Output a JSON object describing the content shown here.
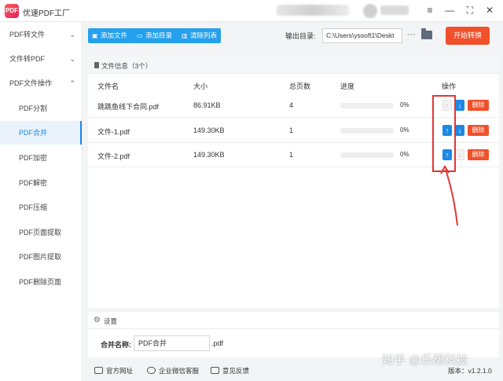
{
  "app": {
    "logo_text": "PDF",
    "title": "优速PDF工厂"
  },
  "window_controls": {
    "menu": "≡",
    "minimize": "—",
    "maximize": "⛶",
    "close": "✕"
  },
  "sidebar": {
    "items": [
      {
        "label": "PDF转文件",
        "chevron": "⌄"
      },
      {
        "label": "文件转PDF",
        "chevron": "⌄"
      },
      {
        "label": "PDF文件操作",
        "chevron": "⌃"
      },
      {
        "label": "PDF分割"
      },
      {
        "label": "PDF合并"
      },
      {
        "label": "PDF加密"
      },
      {
        "label": "PDF解密"
      },
      {
        "label": "PDF压缩"
      },
      {
        "label": "PDF页面提取"
      },
      {
        "label": "PDF图片提取"
      },
      {
        "label": "PDF删除页面"
      }
    ]
  },
  "toolbar": {
    "add_file": "添加文件",
    "add_dir": "添加目录",
    "clear_list": "清除列表",
    "output_label": "输出目录:",
    "output_path": "C:\\Users\\yssoft1\\Deskt",
    "more": "···",
    "start": "开始转换"
  },
  "files": {
    "header": "文件信息（3个）",
    "columns": {
      "name": "文件名",
      "size": "大小",
      "pages": "总页数",
      "progress": "进度",
      "actions": "操作"
    },
    "rows": [
      {
        "name": "跳跳鱼线下合同.pdf",
        "size": "86.91KB",
        "pages": "4",
        "progress_pct": "0%",
        "progress": 0,
        "up": "↑",
        "down": "↓",
        "delete": "删除",
        "up_enabled": false,
        "down_enabled": true
      },
      {
        "name": "文件-1.pdf",
        "size": "149.30KB",
        "pages": "1",
        "progress_pct": "0%",
        "progress": 0,
        "up": "↑",
        "down": "↓",
        "delete": "删除",
        "up_enabled": true,
        "down_enabled": true
      },
      {
        "name": "文件-2.pdf",
        "size": "149.30KB",
        "pages": "1",
        "progress_pct": "0%",
        "progress": 0,
        "up": "↑",
        "down": "↓",
        "delete": "删除",
        "up_enabled": true,
        "down_enabled": false
      }
    ]
  },
  "settings": {
    "title": "设置",
    "merge_label": "合并名称:",
    "merge_value": "PDF合并",
    "merge_ext": ".pdf"
  },
  "footer": {
    "website": "官方网址",
    "wechat": "企业微信客服",
    "feedback": "意见反馈",
    "version": "版本：v1.2.1.0"
  },
  "watermark": "知乎 @乐帮科技",
  "colors": {
    "accent": "#1e88e5",
    "toolbar": "#24a0ed",
    "danger": "#f0502a",
    "annotation": "#e23737"
  }
}
